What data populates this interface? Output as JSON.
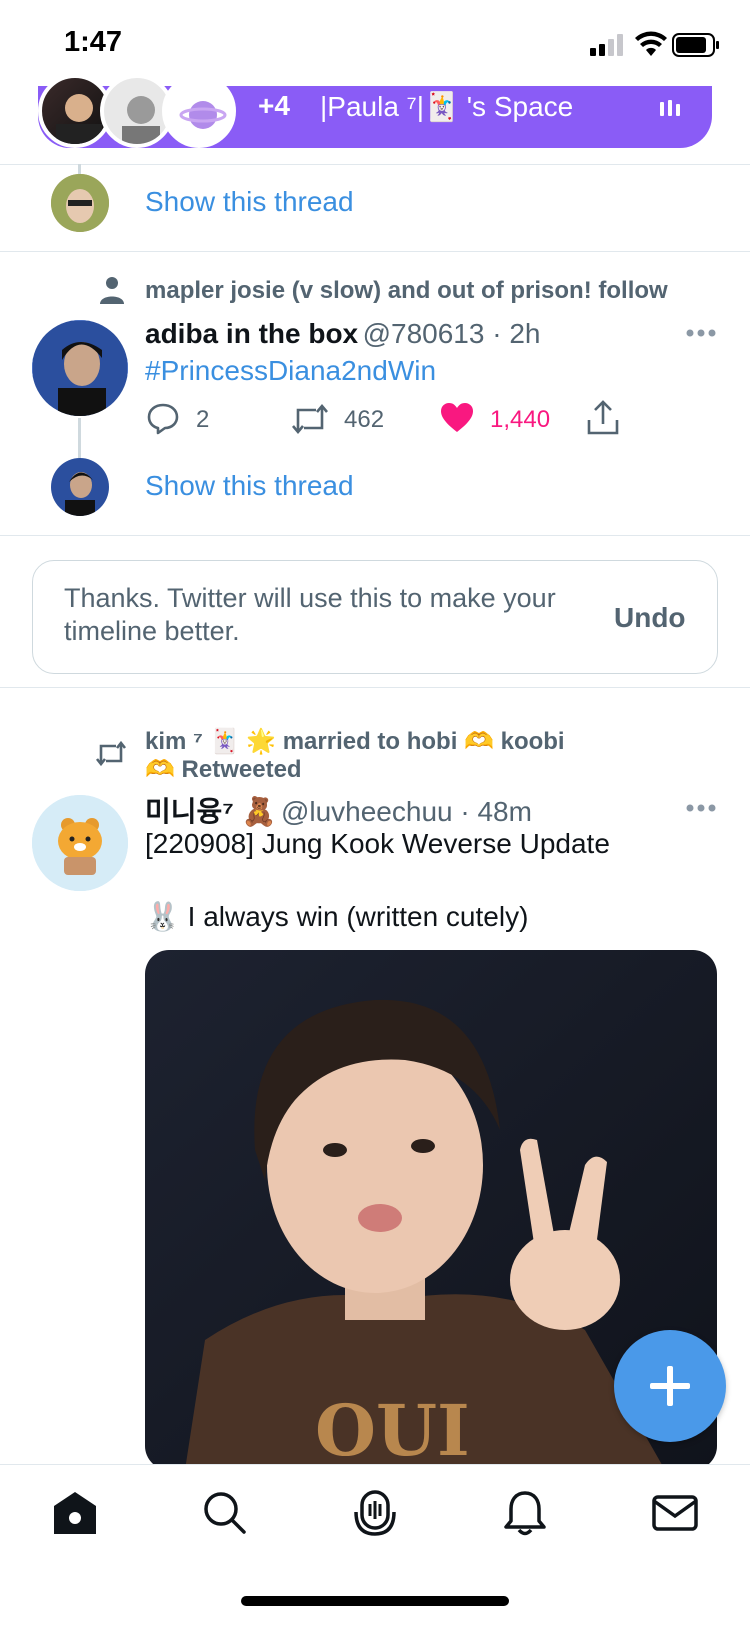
{
  "status_bar": {
    "time": "1:47"
  },
  "space": {
    "count": "+4",
    "title": "|Paula ⁷|🃏 's Space"
  },
  "thread1": {
    "show_thread": "Show this thread"
  },
  "tweet1": {
    "social_context": "mapler josie (v slow) and out of prison! follow",
    "name": "adiba in the box",
    "handle": "@780613 · 2h",
    "text": "#PrincessDiana2ndWin",
    "replies": "2",
    "retweets": "462",
    "likes": "1,440",
    "show_thread": "Show this thread"
  },
  "feedback": {
    "text": "Thanks. Twitter will use this to make your timeline better.",
    "undo": "Undo"
  },
  "tweet2": {
    "retweet_line1": "kim ⁷ 🃏 🌟 married to hobi 🫶 koobi",
    "retweet_line2": "🫶 Retweeted",
    "name": "미니융⁷ 🧸",
    "handle": "@luvheechuu · 48m",
    "text_line1": "[220908] Jung Kook Weverse Update",
    "text_line2": "🐰 I always win (written cutely)"
  },
  "colors": {
    "accent": "#1d9bf0",
    "space_purple": "#8a5cf6",
    "like_pink": "#f91880",
    "muted": "#536471"
  },
  "tabs": [
    "home-icon",
    "search-icon",
    "spaces-icon",
    "notifications-icon",
    "messages-icon"
  ]
}
